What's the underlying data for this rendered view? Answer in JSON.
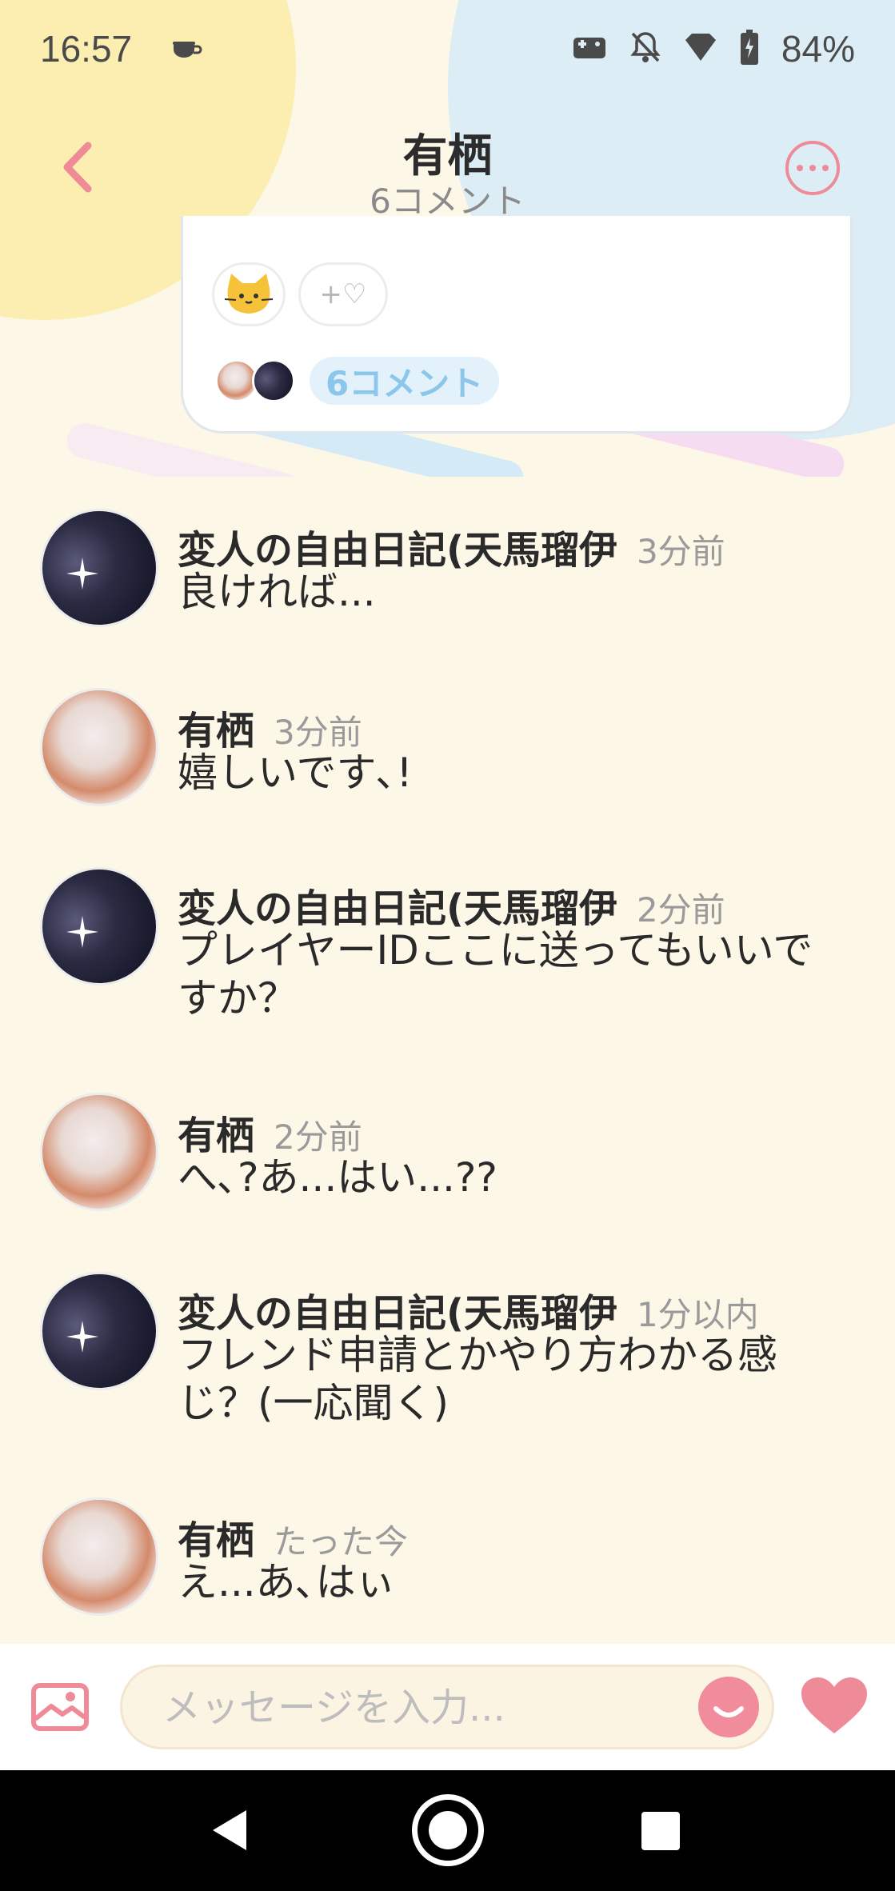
{
  "status_bar": {
    "time": "16:57",
    "battery": "84%",
    "icons": [
      "coffee-icon",
      "gamepad-icon",
      "bell-off-icon",
      "signal-icon",
      "battery-icon"
    ]
  },
  "header": {
    "title": "有栖",
    "subtitle": "6コメント",
    "back_icon": "chevron-left-icon",
    "more_icon": "more-icon"
  },
  "post": {
    "reaction_add_label": "+♡",
    "comment_count_label": "6コメント"
  },
  "comments": [
    {
      "author": "変人の自由日記(天馬瑠伊",
      "time": "3分前",
      "text": "良ければ...",
      "avatar": "dark"
    },
    {
      "author": "有栖",
      "time": "3分前",
      "text": "嬉しいです､!",
      "avatar": "light"
    },
    {
      "author": "変人の自由日記(天馬瑠伊",
      "time": "2分前",
      "text": "プレイヤーIDここに送ってもいいですか？",
      "avatar": "dark"
    },
    {
      "author": "有栖",
      "time": "2分前",
      "text": "へ､?あ...はい...??",
      "avatar": "light"
    },
    {
      "author": "変人の自由日記(天馬瑠伊",
      "time": "1分以内",
      "text": "フレンド申請とかやり方わかる感じ？(一応聞く)",
      "avatar": "dark"
    },
    {
      "author": "有栖",
      "time": "たった今",
      "text": "え...あ､はぃ",
      "avatar": "light"
    }
  ],
  "input_bar": {
    "placeholder": "メッセージを入力..."
  },
  "colors": {
    "accent_pink": "#ef8a99",
    "background_cream": "#fdf7e7",
    "pill_blue": "#8cc6ea"
  }
}
